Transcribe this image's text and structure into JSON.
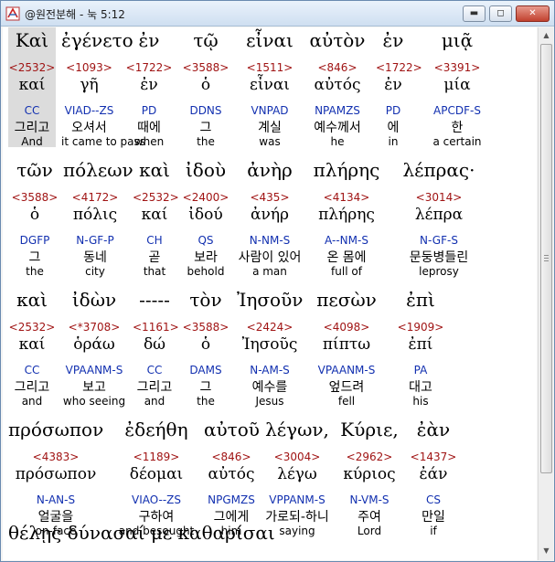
{
  "window": {
    "title": "@원전분해 - 눅 5:12",
    "min_glyph": "▬",
    "max_glyph": "◻",
    "close_glyph": "✕"
  },
  "scroll": {
    "up": "▲",
    "down": "▼"
  },
  "rows": [
    [
      {
        "greek": "Καὶ",
        "strong": "<2532>",
        "lemma": "καί",
        "parse": "CC",
        "korean": "그리고",
        "eng": "And"
      },
      {
        "greek": "ἐγένετο",
        "strong": "<1093>",
        "lemma": "γῆ",
        "parse": "VIAD--ZS",
        "korean": "오셔서",
        "eng": "it came to pass"
      },
      {
        "greek": "ἐν",
        "strong": "<1722>",
        "lemma": "ἐν",
        "parse": "PD",
        "korean": "때에",
        "eng": "when"
      },
      {
        "greek": "τῷ",
        "strong": "<3588>",
        "lemma": "ὁ",
        "parse": "DDNS",
        "korean": "그",
        "eng": "the"
      },
      {
        "greek": "εἶναι",
        "strong": "<1511>",
        "lemma": "εἶναι",
        "parse": "VNPAD",
        "korean": "계실",
        "eng": "was"
      },
      {
        "greek": "αὐτὸν",
        "strong": "<846>",
        "lemma": "αὐτός",
        "parse": "NPAMZS",
        "korean": "예수께서",
        "eng": "he"
      },
      {
        "greek": "ἐν",
        "strong": "<1722>",
        "lemma": "ἐν",
        "parse": "PD",
        "korean": "에",
        "eng": "in"
      },
      {
        "greek": "μιᾷ",
        "strong": "<3391>",
        "lemma": "μία",
        "parse": "APCDF-S",
        "korean": "한",
        "eng": "a certain"
      }
    ],
    [
      {
        "greek": "τῶν",
        "strong": "<3588>",
        "lemma": "ὁ",
        "parse": "DGFP",
        "korean": "그",
        "eng": "the"
      },
      {
        "greek": "πόλεων",
        "strong": "<4172>",
        "lemma": "πόλις",
        "parse": "N-GF-P",
        "korean": "동네",
        "eng": "city"
      },
      {
        "greek": "καὶ",
        "strong": "<2532>",
        "lemma": "καί",
        "parse": "CH",
        "korean": "곧",
        "eng": "that"
      },
      {
        "greek": "ἰδοὺ",
        "strong": "<2400>",
        "lemma": "ἰδού",
        "parse": "QS",
        "korean": "보라",
        "eng": "behold"
      },
      {
        "greek": "ἀνὴρ",
        "strong": "<435>",
        "lemma": "ἀνήρ",
        "parse": "N-NM-S",
        "korean": "사람이 있어",
        "eng": "a man"
      },
      {
        "greek": "πλήρης",
        "strong": "<4134>",
        "lemma": "πλήρης",
        "parse": "A--NM-S",
        "korean": "온 몸에",
        "eng": "full of"
      },
      {
        "greek": "λέπρας·",
        "strong": "<3014>",
        "lemma": "λέπρα",
        "parse": "N-GF-S",
        "korean": "문둥병들린",
        "eng": "leprosy"
      }
    ],
    [
      {
        "greek": "καὶ",
        "strong": "<2532>",
        "lemma": "καί",
        "parse": "CC",
        "korean": "그리고",
        "eng": "and"
      },
      {
        "greek": "ἰδὼν",
        "strong": "<*3708>",
        "lemma": "ὁράω",
        "parse": "VPAANM-S",
        "korean": "보고",
        "eng": "who seeing"
      },
      {
        "greek": "-----",
        "strong": "<1161>",
        "lemma": "δώ",
        "parse": "CC",
        "korean": "그리고",
        "eng": "and"
      },
      {
        "greek": "τὸν",
        "strong": "<3588>",
        "lemma": "ὁ",
        "parse": "DAMS",
        "korean": "그",
        "eng": "the"
      },
      {
        "greek": "Ἰησοῦν",
        "strong": "<2424>",
        "lemma": "Ἰησοῦς",
        "parse": "N-AM-S",
        "korean": "예수를",
        "eng": "Jesus"
      },
      {
        "greek": "πεσὼν",
        "strong": "<4098>",
        "lemma": "πίπτω",
        "parse": "VPAANM-S",
        "korean": "엎드려",
        "eng": "fell"
      },
      {
        "greek": "ἐπὶ",
        "strong": "<1909>",
        "lemma": "ἐπί",
        "parse": "PA",
        "korean": "대고",
        "eng": "his"
      }
    ],
    [
      {
        "greek": "πρόσωπον",
        "strong": "<4383>",
        "lemma": "πρόσωπον",
        "parse": "N-AN-S",
        "korean": "얼굴을",
        "eng": "on-face"
      },
      {
        "greek": "ἐδεήθη",
        "strong": "<1189>",
        "lemma": "δέομαι",
        "parse": "VIAO--ZS",
        "korean": "구하여",
        "eng": "and besought"
      },
      {
        "greek": "αὐτοῦ",
        "strong": "<846>",
        "lemma": "αὐτός",
        "parse": "NPGMZS",
        "korean": "그에게",
        "eng": "him"
      },
      {
        "greek": "λέγων,",
        "strong": "<3004>",
        "lemma": "λέγω",
        "parse": "VPPANM-S",
        "korean": "가로되-하니",
        "eng": "saying"
      },
      {
        "greek": "Κύριε,",
        "strong": "<2962>",
        "lemma": "κύριος",
        "parse": "N-VM-S",
        "korean": "주여",
        "eng": "Lord"
      },
      {
        "greek": "ἐὰν",
        "strong": "<1437>",
        "lemma": "ἐάν",
        "parse": "CS",
        "korean": "만일",
        "eng": "if"
      }
    ]
  ],
  "partial_next_row": "θέλῃς    δύνασαί    με    καθαρίσαι"
}
